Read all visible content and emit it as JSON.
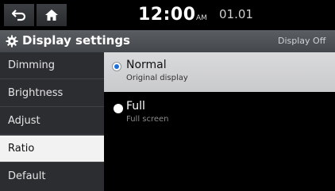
{
  "statusbar": {
    "time": "12:00",
    "ampm": "AM",
    "date": "01.01",
    "back_icon": "back-arrow-icon",
    "home_icon": "home-icon"
  },
  "titlebar": {
    "title": "Display settings",
    "icon": "gear-icon",
    "display_off": "Display Off"
  },
  "sidebar": {
    "items": [
      {
        "label": "Dimming"
      },
      {
        "label": "Brightness"
      },
      {
        "label": "Adjust"
      },
      {
        "label": "Ratio",
        "active": true
      },
      {
        "label": "Default"
      }
    ]
  },
  "options": [
    {
      "label": "Normal",
      "sub": "Original display",
      "selected": true
    },
    {
      "label": "Full",
      "sub": "Full screen",
      "selected": false
    }
  ],
  "colors": {
    "accent": "#1d6fd6",
    "selected_row": "#d9dadc",
    "sidebar_bg": "#2b2d30",
    "active_item": "#f2f2f2"
  }
}
